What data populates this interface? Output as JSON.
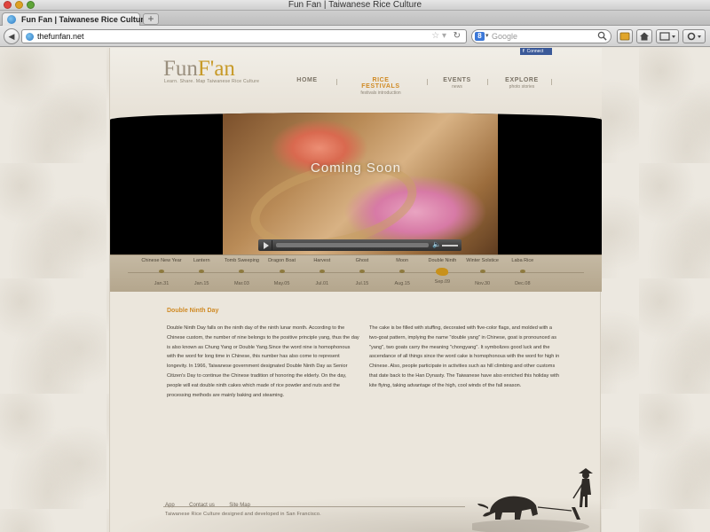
{
  "window": {
    "title": "Fun Fan | Taiwanese Rice Culture"
  },
  "tab": {
    "label": "Fun Fan | Taiwanese Rice Culture",
    "new_tab": "+"
  },
  "toolbar": {
    "url": "thefunfan.net",
    "search_placeholder": "Google",
    "search_engine": "8"
  },
  "site": {
    "facebook": {
      "f": "f",
      "label": "Connect"
    },
    "logo": {
      "part1": "Fun",
      "part2": "F'an",
      "tagline": "Learn. Share. Map Taiwanese Rice Culture"
    },
    "nav": [
      {
        "label": "HOME",
        "sub": ""
      },
      {
        "label": "RICE FESTIVALS",
        "sub": "festivals introduction"
      },
      {
        "label": "EVENTS",
        "sub": "news"
      },
      {
        "label": "EXPLORE",
        "sub": "photo stories"
      }
    ],
    "nav_active_index": 1,
    "video": {
      "overlay": "Coming Soon",
      "play_icon": "play-icon",
      "volume_icon": "volume-icon"
    },
    "festivals": [
      {
        "name": "Chinese New Year",
        "date": "Jan.31"
      },
      {
        "name": "Lantern",
        "date": "Jan.15"
      },
      {
        "name": "Tomb Sweeping",
        "date": "Mar.03"
      },
      {
        "name": "Dragon Boat",
        "date": "May.05"
      },
      {
        "name": "Harvest",
        "date": "Jul.01"
      },
      {
        "name": "Ghost",
        "date": "Jul.15"
      },
      {
        "name": "Moon",
        "date": "Aug.15"
      },
      {
        "name": "Double Ninth",
        "date": "Sep.09"
      },
      {
        "name": "Winter Solstice",
        "date": "Nov.30"
      },
      {
        "name": "Laba Rice",
        "date": "Dec.08"
      }
    ],
    "festival_active_index": 7,
    "content": {
      "title": "Double Ninth Day",
      "left": "Double Ninth Day falls on the ninth day of the ninth lunar month. According to the Chinese custom, the number of nine belongs to the positive principle yang, thus the day is also known as Chung Yang or Double Yang.Since the word nine is homophonous with the word for long time in Chinese, this number has also come to represent longevity. In 1966, Taiwanese government designated Double Ninth Day as Senior Citizen's Day to continue the Chinese tradition of honoring the elderly. On the day, people will eat double ninth cakes which made of rice powder and nuts and the processing methods are mainly baking and steaming.",
      "right": "The cake is be filled with stuffing, decorated with five-color flags, and molded with a two-goat pattern, implying the name \"double yang\" in Chinese, goat is pronounced as \"yang\", two goats carry the meaning \"chongyang\". It symbolizes good luck and the ascendance of all things since the word cake is homophonous with the word for high in Chinese. Also, people participate in activities such as hill climbing and other customs that date back to the Han Dynasty. The Taiwanese have also enriched this holiday with kite flying, taking advantage of the high, cool winds of the fall season."
    },
    "footer": {
      "links": [
        "App",
        "Contact us",
        "Site Map"
      ],
      "copyright": "Taiwanese Rice Culture designed and developed in San Francisco."
    }
  },
  "colors": {
    "accent": "#d08a24",
    "facebook": "#3b5998",
    "text": "#3e382f"
  }
}
